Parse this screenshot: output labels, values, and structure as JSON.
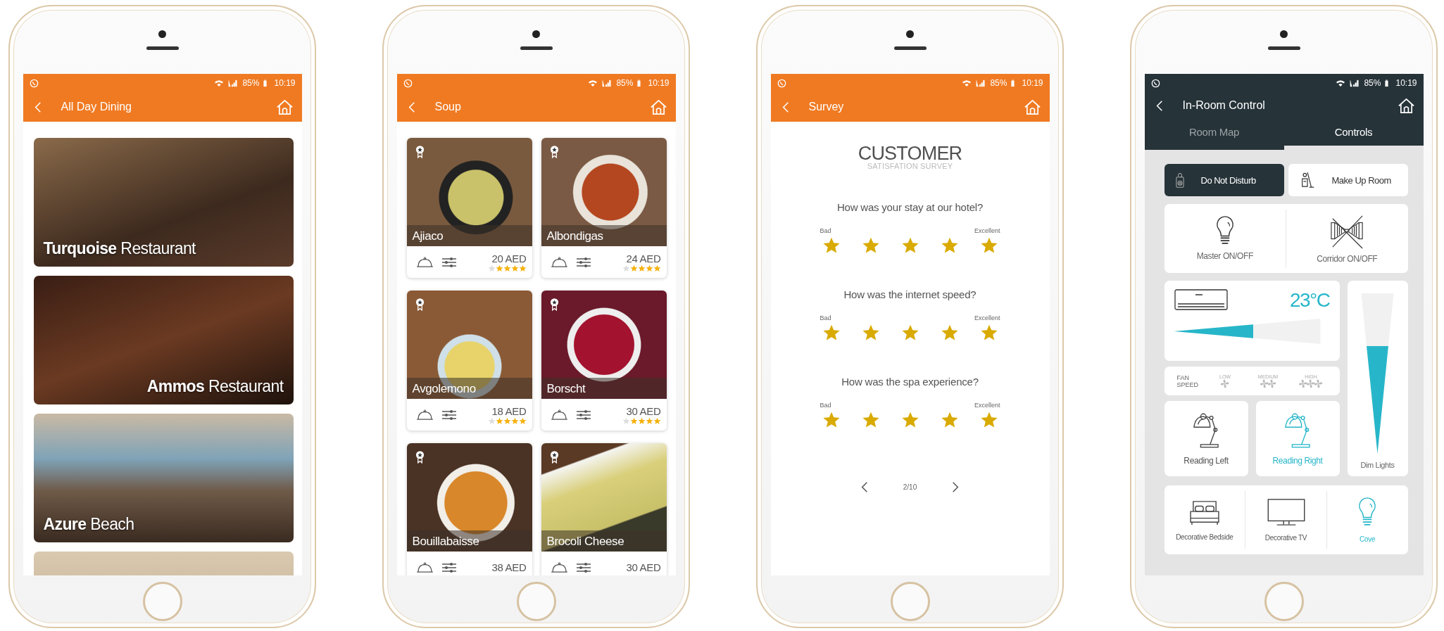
{
  "screens": [
    {
      "kind": "restaurants",
      "status_bar": {
        "battery": "85%",
        "time": "10:19"
      },
      "header": {
        "title": "All Day Dining"
      },
      "restaurants": [
        {
          "name": "**Turquoise** Restaurant",
          "kind": "left"
        },
        {
          "name": "**Ammos** Restaurant",
          "kind": "right"
        },
        {
          "name": "**Azure** Beach",
          "kind": "left"
        }
      ]
    },
    {
      "kind": "dishes",
      "status_bar": {
        "battery": "85%",
        "time": "10:19"
      },
      "header": {
        "title": "Soup"
      },
      "dishes": [
        {
          "name": "Ajiaco",
          "price": "20 AED",
          "stars": 4
        },
        {
          "name": "Albondigas",
          "price": "24 AED",
          "stars": 4
        },
        {
          "name": "Avgolemono",
          "price": "18 AED",
          "stars": 4
        },
        {
          "name": "Borscht",
          "price": "30 AED",
          "stars": 4
        },
        {
          "name": "Bouillabaisse",
          "price": "38 AED"
        },
        {
          "name": "Brocoli Cheese",
          "price": "30 AED"
        }
      ]
    },
    {
      "kind": "survey",
      "status_bar": {
        "battery": "85%",
        "time": "10:19"
      },
      "header": {
        "title": "Survey"
      },
      "title": "CUSTOMER",
      "subtitle": "SATISFATION SURVEY",
      "questions": [
        {
          "text": "How was your stay at our hotel?",
          "low_label": "Bad",
          "high_label": "Excellent",
          "stars": 5
        },
        {
          "text": "How was the internet speed?",
          "low_label": "Bad",
          "high_label": "Excellent",
          "stars": 5
        },
        {
          "text": "How was the spa experience?",
          "low_label": "Bad",
          "high_label": "Excellent",
          "stars": 5
        }
      ],
      "pager": {
        "text": "2/10"
      }
    },
    {
      "kind": "controls",
      "status_bar": {
        "battery": "85%",
        "time": "10:19"
      },
      "header": {
        "title": "In-Room Control"
      },
      "tabs": [
        {
          "label": "Room Map",
          "selected": false
        },
        {
          "label": "Controls",
          "selected": true
        }
      ],
      "service_buttons": [
        {
          "label": "Do Not Disturb",
          "kind": "door-hanger",
          "on": true
        },
        {
          "label": "Make Up Room",
          "kind": "housekeeping",
          "on": false
        }
      ],
      "switches": [
        {
          "label": "Master ON/OFF",
          "kind": "bulb"
        },
        {
          "label": "Corridor ON/OFF",
          "kind": "corridor"
        }
      ],
      "ac": {
        "temperature": "23°C",
        "level": 0.54
      },
      "fan_speed": {
        "label": "FAN SPEED",
        "options": [
          {
            "label": "LOW"
          },
          {
            "label": "MEDIUM"
          },
          {
            "label": "HIGH"
          }
        ]
      },
      "dimmer": {
        "label": "Dim Lights",
        "level": 0.67
      },
      "reading_lights": [
        {
          "label": "Reading Left",
          "on": false
        },
        {
          "label": "Reading Right",
          "on": true
        }
      ],
      "decor_lights": [
        {
          "label": "Decorative Bedside",
          "kind": "bed",
          "on": false
        },
        {
          "label": "Decorative TV",
          "kind": "tv",
          "on": false
        },
        {
          "label": "Cove",
          "kind": "bulb",
          "on": true
        }
      ]
    }
  ]
}
